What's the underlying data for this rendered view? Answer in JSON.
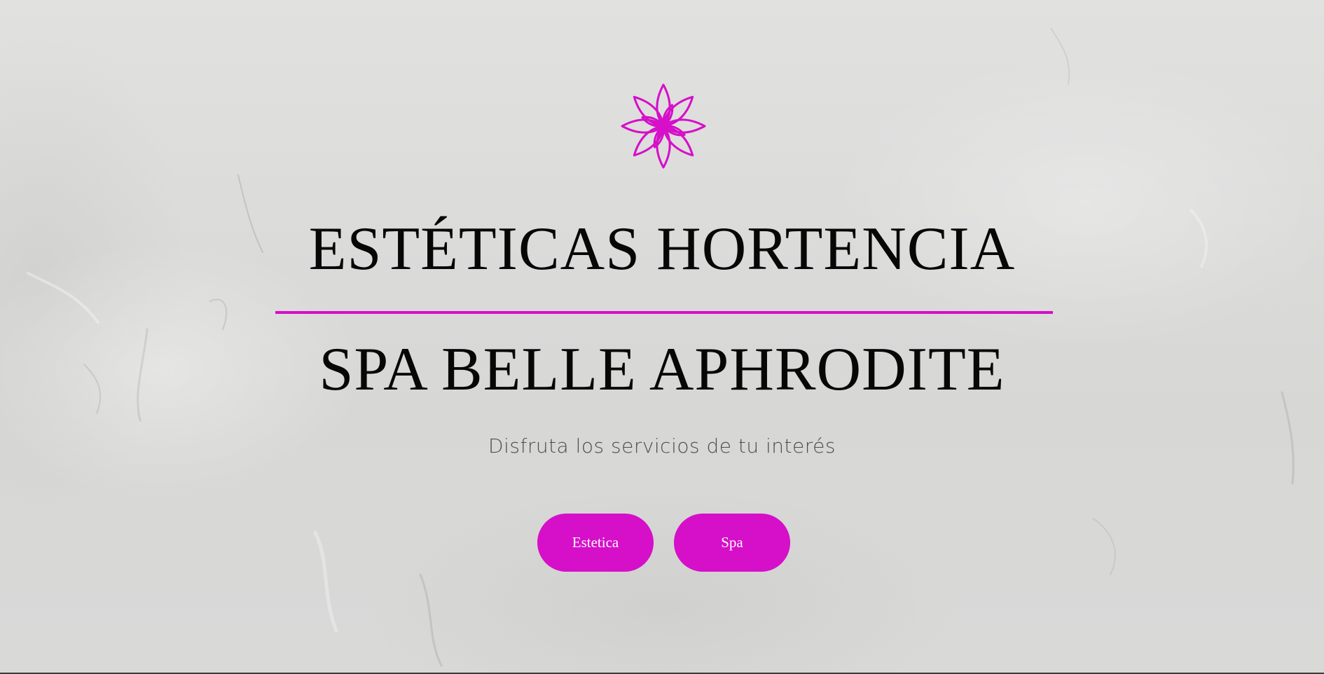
{
  "hero": {
    "logo_icon": "lotus-flower-icon",
    "title_line_1": "ESTÉTICAS HORTENCIA",
    "title_line_2": "SPA BELLE APHRODITE",
    "subtitle": "Disfruta los servicios de tu interés"
  },
  "buttons": {
    "estetica_label": "Estetica",
    "spa_label": "Spa"
  },
  "colors": {
    "accent": "#d60fc9",
    "title_text": "#070707",
    "subtitle_text": "#4d4d4d",
    "background": "#dcdcdb"
  }
}
